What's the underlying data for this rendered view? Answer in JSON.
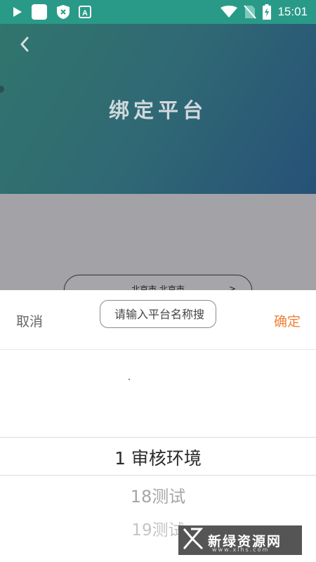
{
  "status_bar": {
    "time": "15:01",
    "icons": [
      "play-icon",
      "app-square-icon",
      "shield-x-icon",
      "translate-a-icon",
      "wifi-icon",
      "no-sim-icon",
      "battery-charging-icon"
    ]
  },
  "header": {
    "title": "绑定平台",
    "back_icon": "chevron-left-icon"
  },
  "city_selector": {
    "value": "北京市 北京市",
    "arrow": ">"
  },
  "sheet": {
    "cancel_label": "取消",
    "confirm_label": "确定",
    "search_placeholder": "请输入平台名称搜",
    "options": [
      "1 审核环境",
      "18测试",
      "19测试"
    ],
    "selected_index": 0
  },
  "watermark": {
    "text": "新绿资源网",
    "url": "www.xlhs.com"
  },
  "colors": {
    "accent": "#f0813a",
    "header_start": "#3c8f84",
    "header_end": "#2f6391",
    "status_bar": "#2a9a88"
  }
}
